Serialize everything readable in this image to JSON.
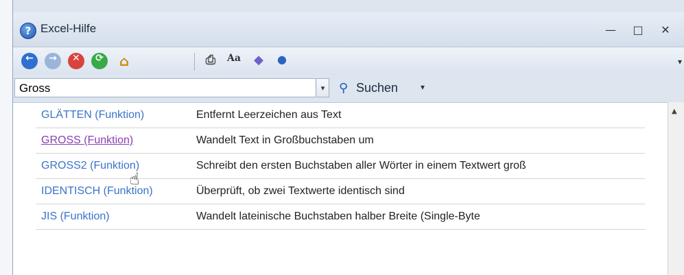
{
  "window": {
    "title": "Excel-Hilfe",
    "controls": {
      "minimize": "—",
      "maximize": "□",
      "close": "✕"
    }
  },
  "toolbar": {
    "icons": [
      "back-icon",
      "forward-icon",
      "stop-icon",
      "refresh-icon",
      "home-icon",
      "print-icon",
      "font-size-icon",
      "book-icon",
      "pin-icon"
    ]
  },
  "search": {
    "value": "Gross",
    "button_label": "Suchen"
  },
  "results": [
    {
      "name": "GLÄTTEN (Funktion)",
      "description": "Entfernt Leerzeichen aus Text"
    },
    {
      "name": "GROSS (Funktion)",
      "description": "Wandelt Text in Großbuchstaben um"
    },
    {
      "name": "GROSS2 (Funktion)",
      "description": "Schreibt den ersten Buchstaben aller Wörter in einem Textwert groß"
    },
    {
      "name": "IDENTISCH (Funktion)",
      "description": "Überprüft, ob zwei Textwerte identisch sind"
    },
    {
      "name": "JIS (Funktion)",
      "description": "Wandelt lateinische Buchstaben halber Breite (Single-Byte"
    }
  ],
  "colors": {
    "link": "#3a73c9",
    "visited_link": "#8a3fb0"
  }
}
